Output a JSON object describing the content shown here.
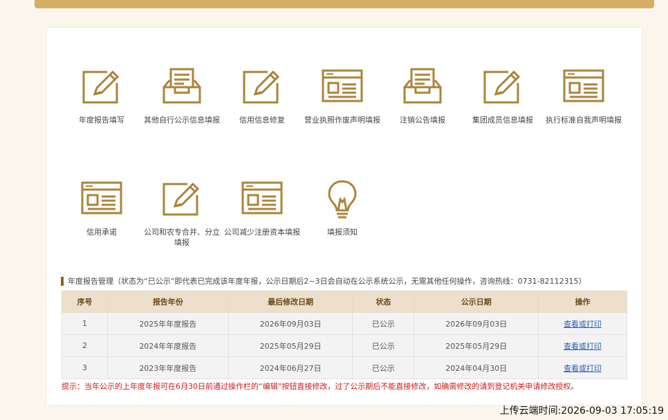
{
  "tiles": [
    {
      "label": "年度报告填写",
      "icon": "edit-icon"
    },
    {
      "label": "其他自行公示信息填报",
      "icon": "inbox-icon"
    },
    {
      "label": "信用信息修复",
      "icon": "edit-icon"
    },
    {
      "label": "营业执照作废声明填报",
      "icon": "form-window-icon"
    },
    {
      "label": "注销公告填报",
      "icon": "inbox-icon"
    },
    {
      "label": "集团成员信息填报",
      "icon": "edit-icon"
    },
    {
      "label": "执行标准自我声明填报",
      "icon": "form-window-icon"
    },
    {
      "label": "信用承诺",
      "icon": "form-window-icon"
    },
    {
      "label": "公司和农专合并、分立填报",
      "icon": "edit-icon"
    },
    {
      "label": "公司减少注册资本填报",
      "icon": "form-window-icon"
    },
    {
      "label": "填报须知",
      "icon": "lightbulb-icon"
    }
  ],
  "annual_reports": {
    "heading": "年度报告管理（状态为“已公示”即代表已完成该年度年报，公示日期后2~3日会自动在公示系统公示，无需其他任何操作，咨询热线：0731-82112315）",
    "columns": [
      "序号",
      "报告年份",
      "最后修改日期",
      "状态",
      "公示日期",
      "操作"
    ],
    "rows": [
      {
        "no": "1",
        "year": "2025年年度报告",
        "modified": "2026年09月03日",
        "status": "已公示",
        "published": "2026年09月03日",
        "action": "查看或打印"
      },
      {
        "no": "2",
        "year": "2024年年度报告",
        "modified": "2025年05月29日",
        "status": "已公示",
        "published": "2025年05月29日",
        "action": "查看或打印"
      },
      {
        "no": "3",
        "year": "2023年年度报告",
        "modified": "2024年06月27日",
        "status": "已公示",
        "published": "2024年04月30日",
        "action": "查看或打印"
      }
    ],
    "hint": "提示：当年公示的上年度年报可在6月30日前通过操作栏的“编辑”按钮直接修改，过了公示期后不能直接修改，如确需修改的请到登记机关申请修改授权。"
  },
  "footer": {
    "timestamp": "上传云端时间:2026-09-03 17:05:19"
  },
  "colors": {
    "accent": "#a9843a",
    "header": "#d4ad66",
    "hint": "#d11a1a",
    "link": "#2b5fb8"
  }
}
